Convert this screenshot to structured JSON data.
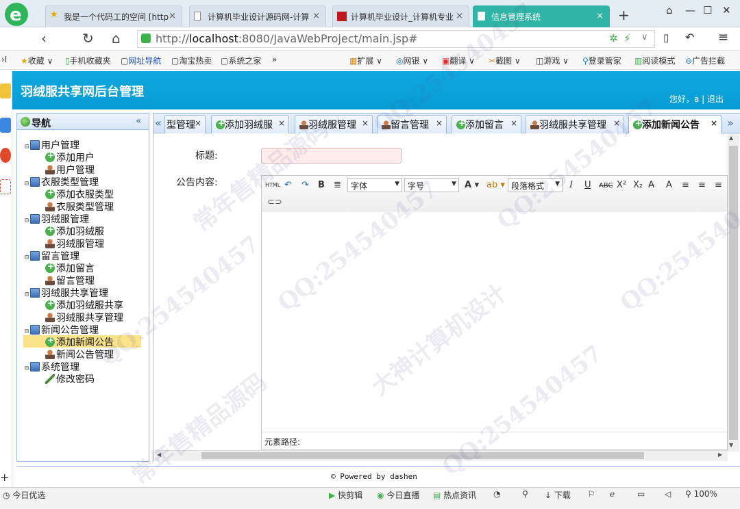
{
  "browser": {
    "tabs": [
      {
        "title": "我是一个代码工的空间 [http"
      },
      {
        "title": "计算机毕业设计源码网-计算"
      },
      {
        "title": "计算机毕业设计_计算机专业"
      },
      {
        "title": "信息管理系统"
      }
    ],
    "url_host": "localhost",
    "url_rest": ":8080/JavaWebProject/main.jsp#",
    "url_scheme": "http://",
    "bookmarks": [
      "收藏",
      "手机收藏夹",
      "网址导航",
      "淘宝热卖",
      "系统之家",
      "»"
    ],
    "toolbar_right": [
      "扩展",
      "网银",
      "翻译",
      "截图",
      "游戏",
      "登录管家",
      "阅读模式",
      "广告拦截"
    ]
  },
  "app": {
    "title": "羽绒服共享网后台管理",
    "greeting": "您好，a",
    "logout": "退出",
    "footer": "© Powered by dashen"
  },
  "nav": {
    "title": "导航",
    "groups": [
      {
        "label": "用户管理",
        "items": [
          {
            "label": "添加用户",
            "icon": "add"
          },
          {
            "label": "用户管理",
            "icon": "user"
          }
        ]
      },
      {
        "label": "衣服类型管理",
        "items": [
          {
            "label": "添加衣服类型",
            "icon": "add"
          },
          {
            "label": "衣服类型管理",
            "icon": "user"
          }
        ]
      },
      {
        "label": "羽绒服管理",
        "items": [
          {
            "label": "添加羽绒服",
            "icon": "add"
          },
          {
            "label": "羽绒服管理",
            "icon": "user"
          }
        ]
      },
      {
        "label": "留言管理",
        "items": [
          {
            "label": "添加留言",
            "icon": "add"
          },
          {
            "label": "留言管理",
            "icon": "user"
          }
        ]
      },
      {
        "label": "羽绒服共享管理",
        "items": [
          {
            "label": "添加羽绒服共享",
            "icon": "add"
          },
          {
            "label": "羽绒服共享管理",
            "icon": "user"
          }
        ]
      },
      {
        "label": "新闻公告管理",
        "items": [
          {
            "label": "添加新闻公告",
            "icon": "add",
            "selected": true
          },
          {
            "label": "新闻公告管理",
            "icon": "user"
          }
        ]
      },
      {
        "label": "系统管理",
        "items": [
          {
            "label": "修改密码",
            "icon": "pen"
          }
        ]
      }
    ]
  },
  "content_tabs": [
    {
      "label": "型管理"
    },
    {
      "label": "添加羽绒服"
    },
    {
      "label": "羽绒服管理"
    },
    {
      "label": "留言管理"
    },
    {
      "label": "添加留言"
    },
    {
      "label": "羽绒服共享管理"
    },
    {
      "label": "添加新闻公告",
      "active": true
    }
  ],
  "form": {
    "title_label": "标题:",
    "title_value": "",
    "content_label": "公告内容:",
    "element_path": "元素路径:"
  },
  "editor": {
    "font_family": "字体",
    "font_size": "字号",
    "paragraph": "段落格式",
    "html_btn": "HTML"
  },
  "statusbar": {
    "left": "今日优选",
    "items": [
      "快剪辑",
      "今日直播",
      "热点资讯",
      "下载"
    ],
    "zoom": "100%"
  },
  "watermark": [
    "QQ:254540457",
    "常年售精品源码",
    "大神计算机设计"
  ]
}
